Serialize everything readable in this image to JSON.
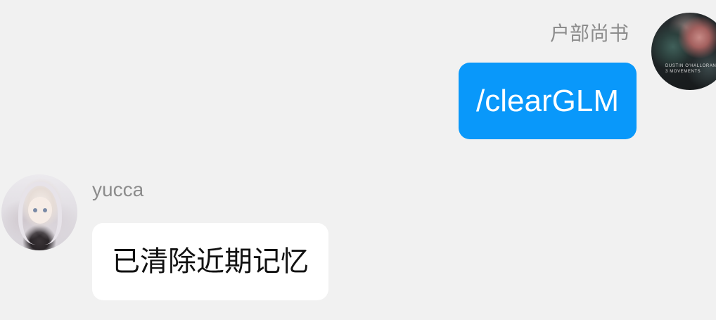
{
  "conversation": {
    "messages": [
      {
        "direction": "outgoing",
        "sender": "户部尚书",
        "avatar_icon": "album-cover-avatar",
        "avatar_text": [
          "DUSTIN O'HALLORAN",
          "3 MOVEMENTS"
        ],
        "text": "/clearGLM",
        "bubble_color": "#0998fa",
        "text_color": "#ffffff"
      },
      {
        "direction": "incoming",
        "sender": "yucca",
        "avatar_icon": "anime-girl-avatar",
        "text": "已清除近期记忆",
        "bubble_color": "#ffffff",
        "text_color": "#111111"
      }
    ]
  },
  "theme": {
    "background": "#f1f1f1",
    "sender_name_color": "#8c8c8c"
  }
}
